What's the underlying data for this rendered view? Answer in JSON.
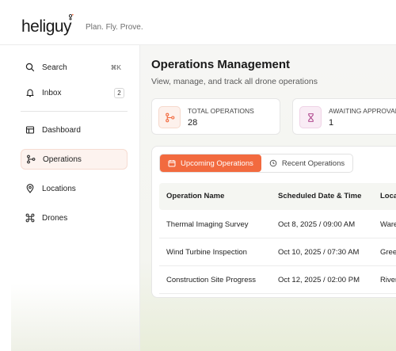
{
  "brand": {
    "logo_text": "heliguy",
    "tagline": "Plan. Fly. Prove."
  },
  "colors": {
    "accent": "#f26a3f",
    "active_bg": "#fdf3ef",
    "pink_icon_bg": "#f9ecf5"
  },
  "sidebar": {
    "search_label": "Search",
    "search_shortcut": "⌘K",
    "inbox_label": "Inbox",
    "inbox_count": "2",
    "items": [
      {
        "label": "Dashboard",
        "icon": "dashboard-icon"
      },
      {
        "label": "Operations",
        "icon": "operations-icon",
        "active": true
      },
      {
        "label": "Locations",
        "icon": "location-pin-icon"
      },
      {
        "label": "Drones",
        "icon": "drone-icon"
      }
    ]
  },
  "main": {
    "title": "Operations Management",
    "subtitle": "View, manage, and track all drone operations",
    "stats": [
      {
        "label": "TOTAL OPERATIONS",
        "value": "28",
        "icon": "operations-icon"
      },
      {
        "label": "AWAITING APPROVAL",
        "value": "1",
        "icon": "hourglass-icon"
      }
    ],
    "tabs": [
      {
        "label": "Upcoming Operations",
        "icon": "calendar-icon",
        "active": true
      },
      {
        "label": "Recent Operations",
        "icon": "history-icon"
      }
    ],
    "table": {
      "headers": [
        "Operation Name",
        "Scheduled Date & Time",
        "Loca"
      ],
      "rows": [
        [
          "Thermal Imaging Survey",
          "Oct 8, 2025 / 09:00 AM",
          "Ware"
        ],
        [
          "Wind Turbine Inspection",
          "Oct 10, 2025 / 07:30 AM",
          "Gree"
        ],
        [
          "Construction Site Progress",
          "Oct 12, 2025 / 02:00 PM",
          "River"
        ]
      ]
    }
  }
}
